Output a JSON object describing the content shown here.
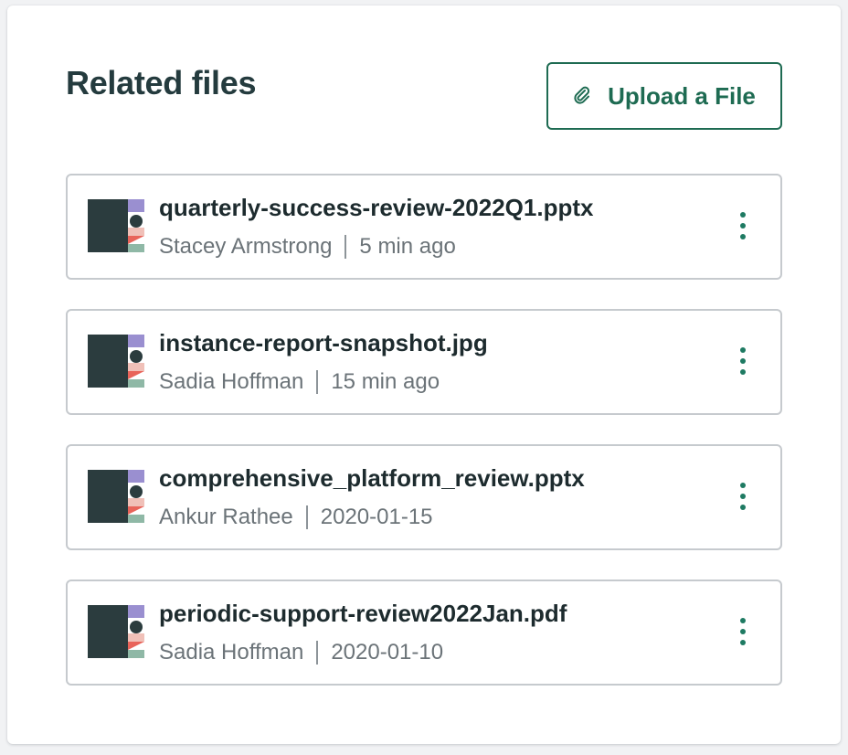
{
  "panel": {
    "title": "Related files",
    "upload_label": "Upload a File"
  },
  "colors": {
    "accent": "#1e6b52",
    "title": "#243b3e",
    "meta_text": "#6b7378",
    "border": "#c6cace"
  },
  "icons": {
    "upload": "paperclip-icon",
    "file_thumb": "file-thumbnail-icon",
    "actions": "more-vertical-icon"
  },
  "files": [
    {
      "name": "quarterly-success-review-2022Q1.pptx",
      "owner": "Stacey Armstrong",
      "time": "5 min ago"
    },
    {
      "name": "instance-report-snapshot.jpg",
      "owner": "Sadia Hoffman",
      "time": "15 min ago"
    },
    {
      "name": "comprehensive_platform_review.pptx",
      "owner": "Ankur Rathee",
      "time": "2020-01-15"
    },
    {
      "name": "periodic-support-review2022Jan.pdf",
      "owner": "Sadia Hoffman",
      "time": "2020-01-10"
    }
  ]
}
